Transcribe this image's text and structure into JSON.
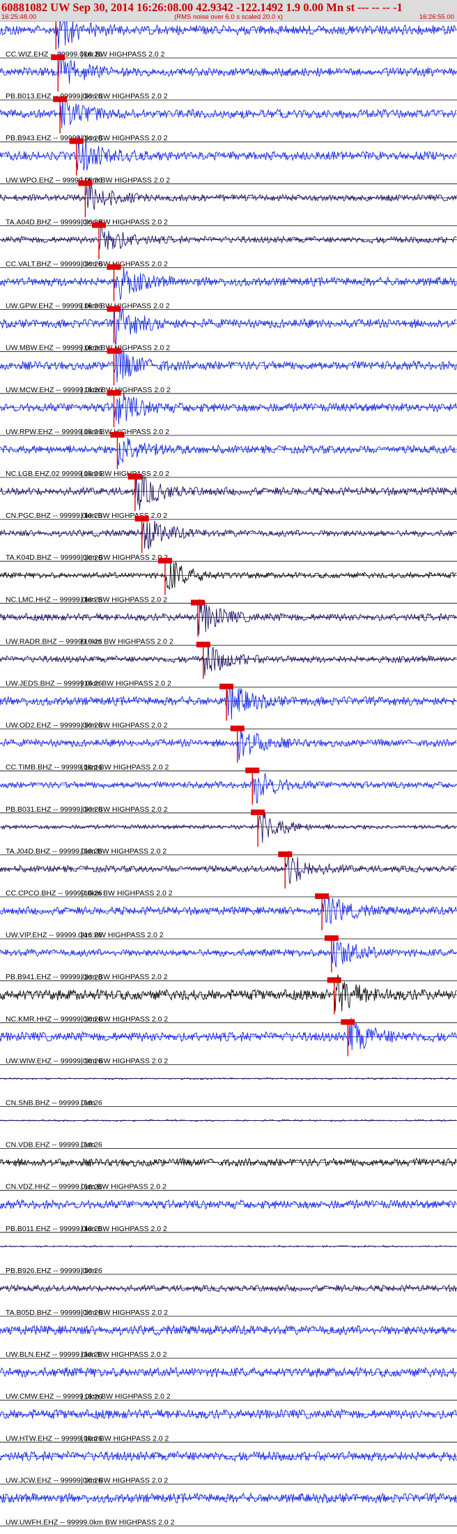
{
  "header": {
    "title": "60881082 UW Sep 30, 2014 16:26:08.00   42.9342 -122.1492  1.9 0.00 Mn st --- -- -- -1",
    "start_time": "16:25:48.00",
    "end_time": "16:26:55.00",
    "note": "(RMS noise over 6.0 s scaled 20.0 x)"
  },
  "chart_data": {
    "type": "line",
    "title": "60881082 UW Sep 30, 2014 16:26:08.00   42.9342 -122.1492  1.9 0.00 Mn st --- -- -- -1",
    "x_range_seconds": [
      0,
      67
    ],
    "time_tick_label": "16:26",
    "time_tick_seconds": 12,
    "grid": false,
    "colors": {
      "blue": "#0a1ee6",
      "navy": "#140a5a",
      "black": "#000000",
      "pick": "#e00000"
    },
    "traces": [
      {
        "label": "CC.WIZ.EHZ -- 99999.0km BW  HIGHPASS  2.0  2",
        "pick": 8.2,
        "color": "blue",
        "noise": 0.22
      },
      {
        "label": "PB.B013.EHZ -- 99999.0km BW  HIGHPASS  2.0  2",
        "pick": 8.5,
        "color": "blue",
        "noise": 0.2
      },
      {
        "label": "PB.B943.EHZ -- 99999.0km BW  HIGHPASS  2.0  2",
        "pick": 8.8,
        "color": "blue",
        "noise": 0.2
      },
      {
        "label": "UW.WPO.EHZ -- 99999.0km BW  HIGHPASS  2.0  2",
        "pick": 11.2,
        "color": "blue",
        "noise": 0.2
      },
      {
        "label": "TA.A04D.BHZ -- 99999.0km BW  HIGHPASS  2.0  2",
        "pick": 12.5,
        "color": "navy",
        "noise": 0.14
      },
      {
        "label": "CC.VALT.BHZ -- 99999.0km BW  HIGHPASS  2.0  2",
        "pick": 14.5,
        "color": "navy",
        "noise": 0.14
      },
      {
        "label": "UW.GPW.EHZ -- 99999.0km BW  HIGHPASS  2.0  2",
        "pick": 16.7,
        "color": "blue",
        "noise": 0.2
      },
      {
        "label": "UW.MBW.EHZ -- 99999.0km BW  HIGHPASS  2.0  2",
        "pick": 16.7,
        "color": "blue",
        "noise": 0.2
      },
      {
        "label": "UW.MCW.EHZ -- 99999.0km BW  HIGHPASS  2.0  2",
        "pick": 16.7,
        "color": "blue",
        "noise": 0.2
      },
      {
        "label": "UW.RPW.EHZ -- 99999.0km BW  HIGHPASS  2.0  2",
        "pick": 16.7,
        "color": "blue",
        "noise": 0.2
      },
      {
        "label": "NC.LGB.EHZ.02 99999.0km BW  HIGHPASS  2.0  2",
        "pick": 17.2,
        "color": "blue",
        "noise": 0.18
      },
      {
        "label": "CN.PGC.BHZ -- 99999.0km BW  HIGHPASS  2.0  2",
        "pick": 19.8,
        "color": "navy",
        "noise": 0.18
      },
      {
        "label": "TA.K04D.BHZ -- 99999.0km BW  HIGHPASS  2.0  2",
        "pick": 20.8,
        "color": "navy",
        "noise": 0.14
      },
      {
        "label": "NC.LMC.HHZ -- 99999.0km BW  HIGHPASS  2.0  2",
        "pick": 24.2,
        "color": "black",
        "noise": 0.12
      },
      {
        "label": "UW.RADR.BHZ -- 99999.0km BW  HIGHPASS  2.0  2",
        "pick": 29.0,
        "color": "navy",
        "noise": 0.16
      },
      {
        "label": "UW.JEDS.BHZ -- 99999.0km BW  HIGHPASS  2.0  2",
        "pick": 29.8,
        "color": "navy",
        "noise": 0.14
      },
      {
        "label": "UW.OD2.EHZ -- 99999.0km BW  HIGHPASS  2.0  2",
        "pick": 33.2,
        "color": "blue",
        "noise": 0.2
      },
      {
        "label": "CC.TIMB.BHZ -- 99999.0km BW  HIGHPASS  2.0  2",
        "pick": 34.8,
        "color": "blue",
        "noise": 0.16
      },
      {
        "label": "PB.B031.EHZ -- 99999.0km BW  HIGHPASS  2.0  2",
        "pick": 37.0,
        "color": "blue",
        "noise": 0.14
      },
      {
        "label": "TA.J04D.BHZ -- 99999.0km BW  HIGHPASS  2.0  2",
        "pick": 37.8,
        "color": "navy",
        "noise": 0.08
      },
      {
        "label": "CC.CPCO.BHZ -- 99999.0km BW  HIGHPASS  2.0  2",
        "pick": 41.8,
        "color": "navy",
        "noise": 0.14
      },
      {
        "label": "UW.VIP.EHZ -- 99999.0km BW  HIGHPASS  2.0  2",
        "pick": 47.2,
        "color": "blue",
        "noise": 0.18
      },
      {
        "label": "PB.B941.EHZ -- 99999.0km BW  HIGHPASS  2.0  2",
        "pick": 48.6,
        "color": "blue",
        "noise": 0.16
      },
      {
        "label": "NC.KMR.HHZ -- 99999.0km BW  HIGHPASS  2.0  2",
        "pick": 49.0,
        "color": "black",
        "noise": 0.25
      },
      {
        "label": "UW.WIW.EHZ -- 99999.0km BW  HIGHPASS  2.0  2",
        "pick": 51.0,
        "color": "blue",
        "noise": 0.22
      },
      {
        "label": "CN.SNB.BHZ -- 99999.0km",
        "pick": null,
        "color": "navy",
        "noise": 0.0
      },
      {
        "label": "CN.VDB.EHZ -- 99999.0km",
        "pick": null,
        "color": "navy",
        "noise": 0.0
      },
      {
        "label": "CN.VDZ.HHZ -- 99999.0km BW  HIGHPASS  2.0  2",
        "pick": null,
        "color": "black",
        "noise": 0.18
      },
      {
        "label": "PB.B011.EHZ -- 99999.0km BW  HIGHPASS  2.0  2",
        "pick": null,
        "color": "blue",
        "noise": 0.2
      },
      {
        "label": "PB.B926.EHZ -- 99999.0km",
        "pick": null,
        "color": "navy",
        "noise": 0.0
      },
      {
        "label": "TA.B05D.BHZ -- 99999.0km BW  HIGHPASS  2.0  2",
        "pick": null,
        "color": "navy",
        "noise": 0.14
      },
      {
        "label": "UW.BLN.EHZ -- 99999.0km BW  HIGHPASS  2.0  2",
        "pick": null,
        "color": "blue",
        "noise": 0.22
      },
      {
        "label": "UW.CMW.EHZ -- 99999.0km BW  HIGHPASS  2.0  2",
        "pick": null,
        "color": "blue",
        "noise": 0.22
      },
      {
        "label": "UW.HTW.EHZ -- 99999.0km BW  HIGHPASS  2.0  2",
        "pick": null,
        "color": "blue",
        "noise": 0.22
      },
      {
        "label": "UW.JCW.EHZ -- 99999.0km BW  HIGHPASS  2.0  2",
        "pick": null,
        "color": "blue",
        "noise": 0.22
      },
      {
        "label": "UW.UWFH.EHZ -- 99999.0km BW  HIGHPASS  2.0  2",
        "pick": null,
        "color": "blue",
        "noise": 0.22
      }
    ]
  }
}
